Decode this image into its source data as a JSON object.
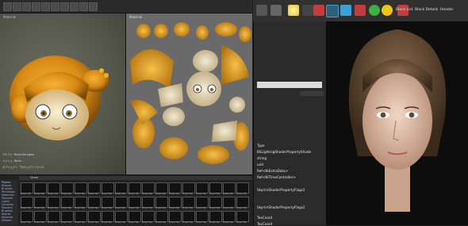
{
  "viewport_left": {
    "label": "Material"
  },
  "viewport_uv": {
    "label": "Material"
  },
  "toolbar": {
    "block_list": "Block List",
    "block_details": "Block Details",
    "header": "Header"
  },
  "properties": [
    {
      "text": "Type"
    },
    {
      "text": "BSLightingShaderPropertyShade"
    },
    {
      "text": "string"
    },
    {
      "text": "uint"
    },
    {
      "text": "Ref<NiExtraData>"
    },
    {
      "text": "Ref<NiTimeController>"
    },
    {
      "text": "SkyrimShaderPropertyFlags1"
    },
    {
      "text": "SkyrimShaderPropertyFlags2"
    },
    {
      "text": "TexCoord"
    },
    {
      "text": "TexCoord"
    }
  ],
  "side_list": [
    "Project",
    "Shapes",
    "Brushes",
    "Primitives",
    "Materials",
    "Textures",
    "Lights",
    "Cameras",
    "Shaders",
    "Brushes",
    "Alphas",
    "Volumes",
    "Deform"
  ],
  "info_rows": [
    {
      "k": "アルファ",
      "v": "Brush tile alpha"
    },
    {
      "k": "メッシュ",
      "v": "Brush ..."
    },
    {
      "k": "オブジェクト",
      "v": "プロジェクトファイル"
    }
  ],
  "palette": {
    "tab": "Stroke",
    "tile_label": "Brush Tile"
  },
  "colors": {
    "accent": "#3aa0d8",
    "brand_red": "#c43c3c",
    "yellow": "#f0c419",
    "green": "#3cb043"
  }
}
